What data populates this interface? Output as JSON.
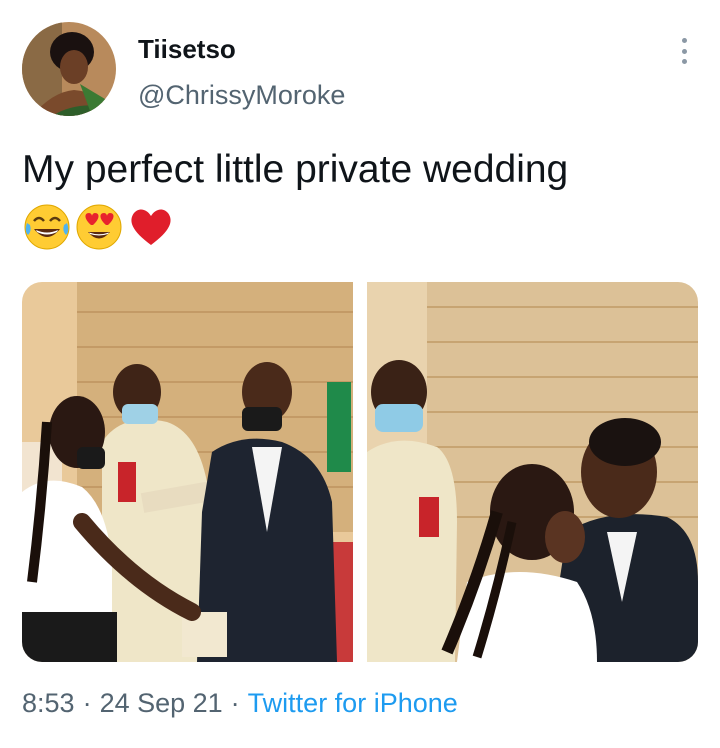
{
  "tweet": {
    "author_name": "Tiisetso",
    "author_handle": "@ChrissyMoroke",
    "text": "My perfect little private wedding",
    "emojis": [
      "joy-face-emoji",
      "heart-eyes-emoji",
      "red-heart-emoji"
    ],
    "time": "8:53",
    "date": "24 Sep 21",
    "separator": "·",
    "source": "Twitter for iPhone"
  },
  "colors": {
    "text": "#0f1419",
    "secondary": "#536471",
    "link": "#1d9bf0"
  }
}
